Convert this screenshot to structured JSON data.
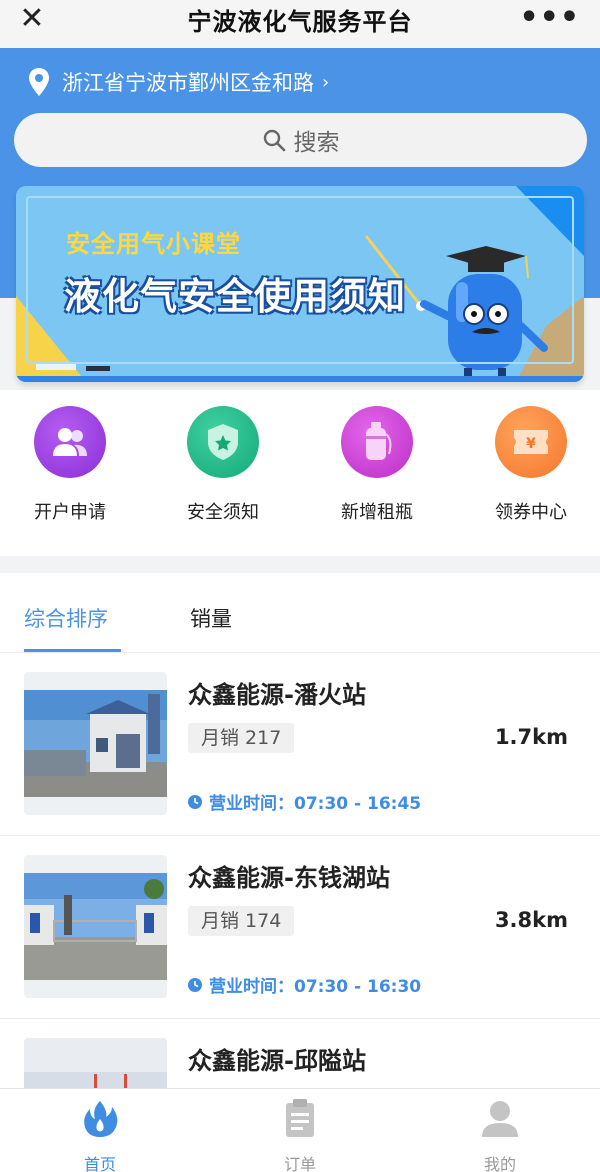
{
  "titlebar": {
    "title": "宁波液化气服务平台",
    "close_glyph": "✕",
    "more_glyph": "•••"
  },
  "location": {
    "text": "浙江省宁波市鄞州区金和路",
    "arrow": "›",
    "icon": "location-pin-icon"
  },
  "search": {
    "placeholder": "搜索",
    "icon": "search-icon"
  },
  "banner": {
    "subtitle": "安全用气小课堂",
    "title": "液化气安全使用须知"
  },
  "quick_actions": [
    {
      "label": "开户申请",
      "icon": "users-icon",
      "color": "#9b3be3"
    },
    {
      "label": "安全须知",
      "icon": "shield-star-icon",
      "color": "#23b98a"
    },
    {
      "label": "新增租瓶",
      "icon": "gas-cylinder-icon",
      "color": "#cf3fd3"
    },
    {
      "label": "领券中心",
      "icon": "coupon-icon",
      "color": "#f4873a"
    }
  ],
  "tabs": [
    {
      "label": "综合排序",
      "active": true
    },
    {
      "label": "销量",
      "active": false
    }
  ],
  "stores": [
    {
      "name": "众鑫能源-潘火站",
      "sales": "月销 217",
      "distance": "1.7km",
      "hours": "营业时间：07:30 - 16:45"
    },
    {
      "name": "众鑫能源-东钱湖站",
      "sales": "月销 174",
      "distance": "3.8km",
      "hours": "营业时间：07:30 - 16:30"
    },
    {
      "name": "众鑫能源-邱隘站",
      "sales": "",
      "distance": "",
      "hours": ""
    }
  ],
  "bottom_nav": [
    {
      "label": "首页",
      "icon": "home-flame-icon",
      "active": true
    },
    {
      "label": "订单",
      "icon": "clipboard-icon",
      "active": false
    },
    {
      "label": "我的",
      "icon": "user-icon",
      "active": false
    }
  ],
  "colors": {
    "primary": "#4b93e6",
    "link": "#3f8de3"
  }
}
